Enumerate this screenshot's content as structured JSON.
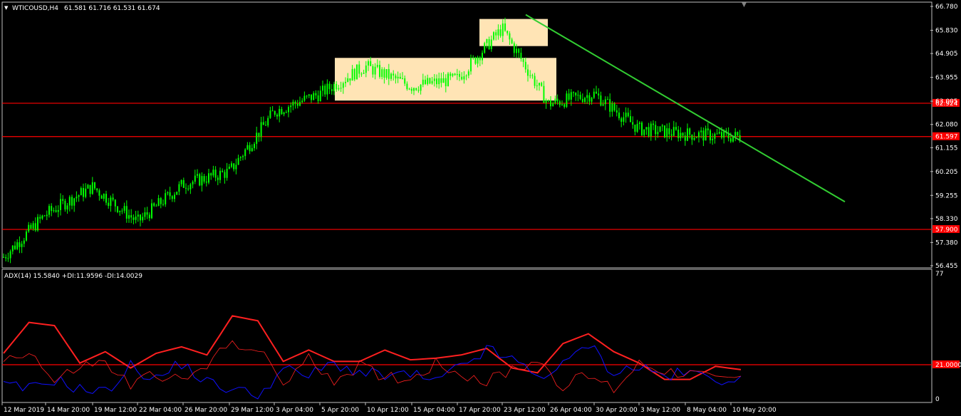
{
  "window": {
    "menu_arrow": "▼",
    "scroll_marker": "▼"
  },
  "price_panel": {
    "symbol_label": "WTICOUSD,H4",
    "ohlc_label": "61.581 61.716 61.531 61.674"
  },
  "indicator_panel": {
    "label": "ADX(14) 15.5840 +DI:11.9596 -DI:14.0029"
  },
  "colors": {
    "background": "#000000",
    "frame": "#c0c0c0",
    "grid": "#1a1a1a",
    "candle": "#00ff00",
    "level_line": "#ff0000",
    "level_label_bg": "#ff0000",
    "zone_fill": "#ffe4b5",
    "trend_line": "#32cd32",
    "adx": "#ff2020",
    "plus_di": "#1010ff",
    "minus_di": "#ff2020"
  },
  "chart_data": [
    {
      "type": "candlestick",
      "title": "WTICOUSD,H4",
      "y_ticks": [
        "66.780",
        "65.830",
        "64.905",
        "63.955",
        "63.005",
        "62.080",
        "61.155",
        "60.205",
        "59.255",
        "58.330",
        "57.380",
        "56.455"
      ],
      "ylim": [
        56.455,
        66.78
      ],
      "x_ticks": [
        "12 Mar 2019",
        "14 Mar 20:00",
        "19 Mar 12:00",
        "22 Mar 04:00",
        "26 Mar 20:00",
        "29 Mar 12:00",
        "3 Apr 04:00",
        "5 Apr 20:00",
        "10 Apr 12:00",
        "15 Apr 04:00",
        "17 Apr 20:00",
        "23 Apr 12:00",
        "26 Apr 04:00",
        "30 Apr 20:00",
        "3 May 12:00",
        "8 May 04:00",
        "10 May 20:00"
      ],
      "horizontal_levels": [
        {
          "value": 62.924,
          "label": "62.924"
        },
        {
          "value": 61.597,
          "label": "61.597"
        },
        {
          "value": 57.9,
          "label": "57.900"
        }
      ],
      "zones": [
        {
          "start": "5 Apr 20:00",
          "end": "26 Apr 04:00",
          "top": 64.73,
          "bottom": 63.03
        },
        {
          "start": "17 Apr 20:00",
          "end": "26 Apr 04:00",
          "top": 66.28,
          "bottom": 65.2
        }
      ],
      "trend_line": {
        "start": {
          "x": "23 Apr 12:00",
          "y": 66.45
        },
        "end": {
          "x": "10 May 20:00",
          "y": 59.0
        }
      },
      "price_path": [
        [
          "12 Mar 2019",
          56.8
        ],
        [
          "14 Mar 20:00",
          58.5
        ],
        [
          "19 Mar 12:00",
          59.6
        ],
        [
          "22 Mar 04:00",
          58.2
        ],
        [
          "26 Mar 20:00",
          59.7
        ],
        [
          "29 Mar 12:00",
          60.2
        ],
        [
          "3 Apr 04:00",
          62.6
        ],
        [
          "5 Apr 20:00",
          63.3
        ],
        [
          "10 Apr 12:00",
          64.4
        ],
        [
          "15 Apr 04:00",
          63.6
        ],
        [
          "17 Apr 20:00",
          63.9
        ],
        [
          "23 Apr 12:00",
          65.9
        ],
        [
          "26 Apr 04:00",
          62.9
        ],
        [
          "30 Apr 20:00",
          63.3
        ],
        [
          "3 May 12:00",
          61.9
        ],
        [
          "8 May 04:00",
          61.7
        ],
        [
          "10 May 20:00",
          61.6
        ]
      ],
      "last": {
        "open": 61.581,
        "high": 61.716,
        "low": 61.531,
        "close": 61.674
      }
    },
    {
      "type": "line",
      "title": "ADX(14) 15.5840 +DI:11.9596 -DI:14.0029",
      "y_ticks": [
        "77",
        "21.0000",
        "0"
      ],
      "ylim": [
        0,
        77
      ],
      "level": {
        "value": 21,
        "label": "21.0000"
      },
      "series": [
        {
          "key": "adx",
          "values": [
            28,
            47,
            45,
            22,
            29,
            19,
            28,
            32,
            27,
            51,
            48,
            23,
            30,
            23,
            23,
            30,
            24,
            25,
            27,
            31,
            19,
            16,
            34,
            40,
            29,
            22,
            12,
            12,
            20,
            18
          ]
        },
        {
          "key": "plus_di",
          "values": [
            8,
            6,
            12,
            6,
            4,
            20,
            12,
            22,
            10,
            6,
            2,
            18,
            14,
            22,
            16,
            14,
            15,
            10,
            20,
            30,
            24,
            14,
            20,
            34,
            16,
            20,
            14,
            16,
            12,
            14
          ]
        },
        {
          "key": "minus_di",
          "values": [
            24,
            30,
            10,
            20,
            22,
            8,
            16,
            10,
            20,
            36,
            30,
            10,
            24,
            12,
            20,
            14,
            12,
            22,
            16,
            10,
            18,
            24,
            8,
            14,
            6,
            22,
            18,
            16,
            12,
            14
          ]
        }
      ]
    }
  ]
}
